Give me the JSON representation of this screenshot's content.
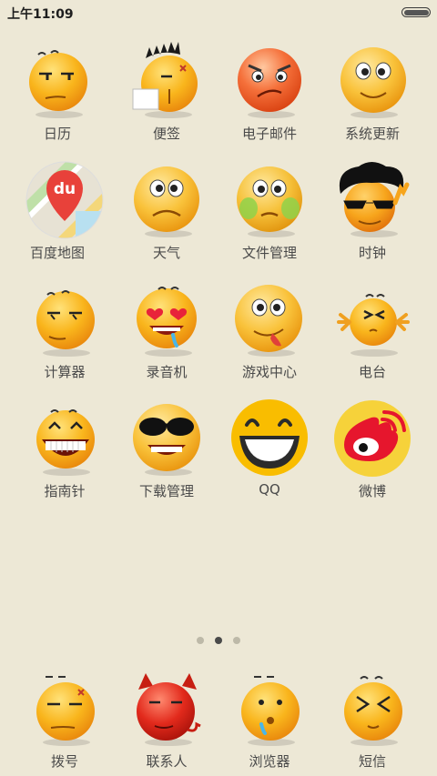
{
  "status_bar": {
    "time": "上午11:09",
    "battery_level": 1.0
  },
  "apps": [
    {
      "label": "日历",
      "icon": "calendar-emoji-icon"
    },
    {
      "label": "便签",
      "icon": "notes-emoji-icon"
    },
    {
      "label": "电子邮件",
      "icon": "email-emoji-icon"
    },
    {
      "label": "系统更新",
      "icon": "system-update-emoji-icon"
    },
    {
      "label": "百度地图",
      "icon": "baidu-map-icon"
    },
    {
      "label": "天气",
      "icon": "weather-emoji-icon"
    },
    {
      "label": "文件管理",
      "icon": "file-manager-emoji-icon"
    },
    {
      "label": "时钟",
      "icon": "clock-emoji-icon"
    },
    {
      "label": "计算器",
      "icon": "calculator-emoji-icon"
    },
    {
      "label": "录音机",
      "icon": "recorder-emoji-icon"
    },
    {
      "label": "游戏中心",
      "icon": "game-center-emoji-icon"
    },
    {
      "label": "电台",
      "icon": "radio-emoji-icon"
    },
    {
      "label": "指南针",
      "icon": "compass-emoji-icon"
    },
    {
      "label": "下载管理",
      "icon": "download-manager-emoji-icon"
    },
    {
      "label": "QQ",
      "icon": "qq-emoji-icon"
    },
    {
      "label": "微博",
      "icon": "weibo-icon"
    }
  ],
  "map_icon_text": "du",
  "pager": {
    "pages": 3,
    "current": 2
  },
  "dock": [
    {
      "label": "拨号",
      "icon": "dialer-emoji-icon"
    },
    {
      "label": "联系人",
      "icon": "contacts-devil-emoji-icon"
    },
    {
      "label": "浏览器",
      "icon": "browser-emoji-icon"
    },
    {
      "label": "短信",
      "icon": "messages-emoji-icon"
    }
  ],
  "colors": {
    "background": "#ede8d6",
    "emoji_yellow": "#f7b21d",
    "devil_red": "#e22a1c",
    "weibo_red": "#e6162d"
  }
}
